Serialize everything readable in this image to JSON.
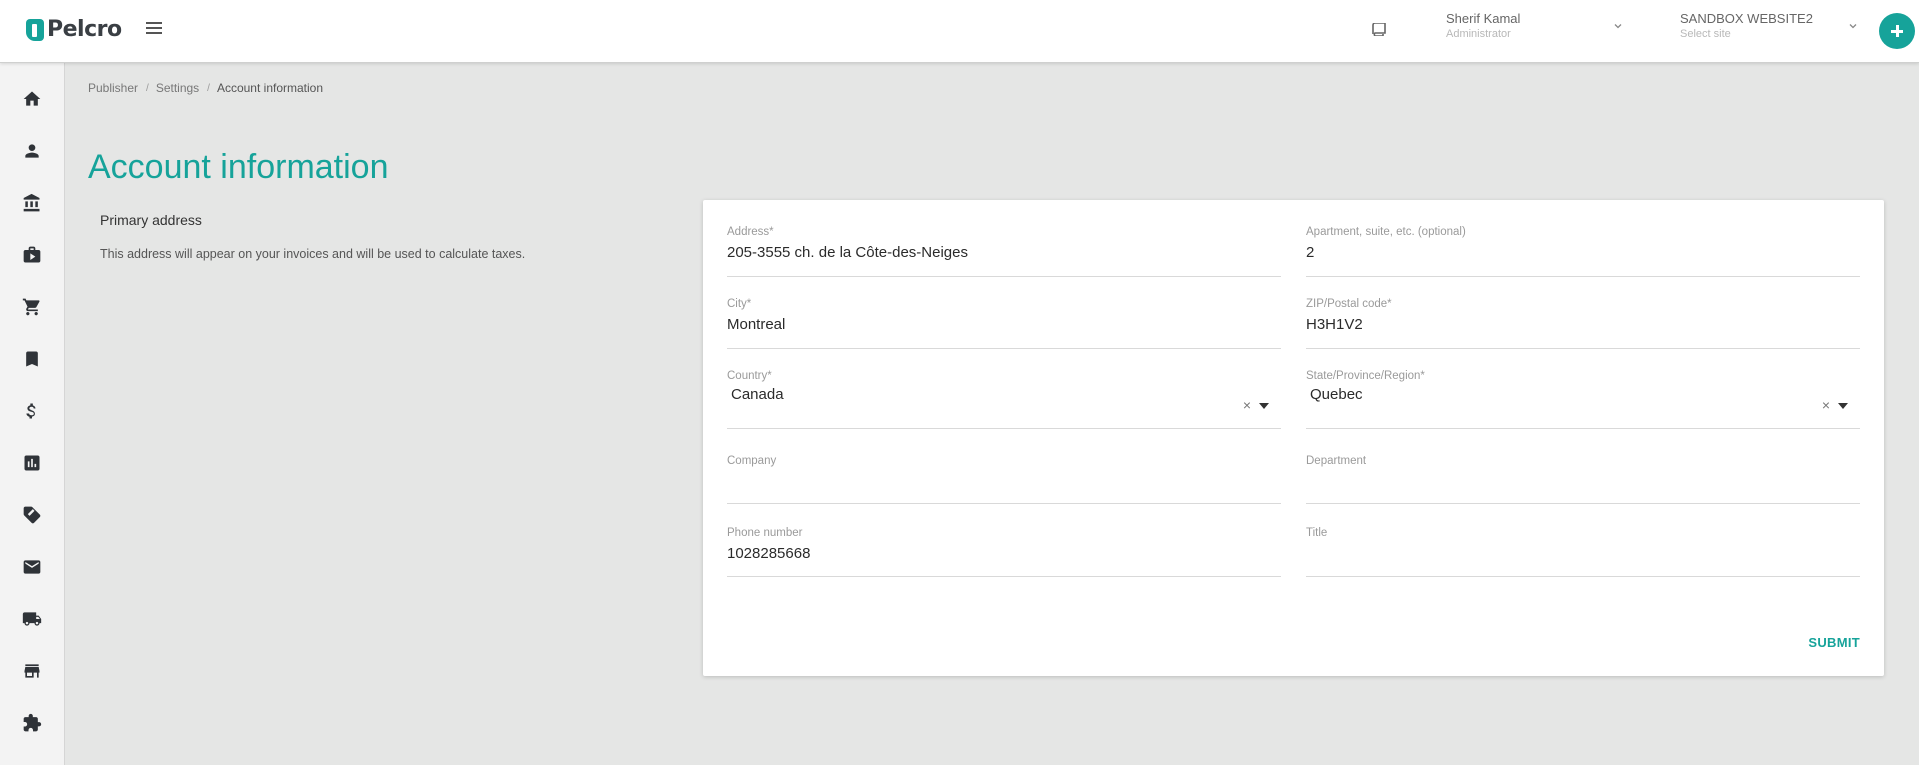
{
  "brand": {
    "name": "Pelcro",
    "accent": "#16a39a"
  },
  "header": {
    "user_name": "Sherif Kamal",
    "user_role": "Administrator",
    "site_name": "SANDBOX WEBSITE2",
    "site_placeholder": "Select site"
  },
  "sidebar": {
    "items": [
      {
        "icon": "home-icon"
      },
      {
        "icon": "person-icon"
      },
      {
        "icon": "bank-icon"
      },
      {
        "icon": "briefcase-icon"
      },
      {
        "icon": "cart-icon"
      },
      {
        "icon": "bookmark-icon"
      },
      {
        "icon": "dollar-icon"
      },
      {
        "icon": "chart-icon"
      },
      {
        "icon": "ticket-icon"
      },
      {
        "icon": "mail-icon"
      },
      {
        "icon": "truck-icon"
      },
      {
        "icon": "store-icon"
      },
      {
        "icon": "puzzle-icon"
      }
    ]
  },
  "breadcrumb": {
    "items": [
      "Publisher",
      "Settings",
      "Account information"
    ]
  },
  "page": {
    "title": "Account information",
    "section_title": "Primary address",
    "section_desc": "This address will appear on your invoices and will be used to calculate taxes."
  },
  "form": {
    "address": {
      "label": "Address*",
      "value": "205-3555 ch. de la Côte-des-Neiges"
    },
    "apartment": {
      "label": "Apartment, suite, etc. (optional)",
      "value": "2"
    },
    "city": {
      "label": "City*",
      "value": "Montreal"
    },
    "zip": {
      "label": "ZIP/Postal code*",
      "value": "H3H1V2"
    },
    "country": {
      "label": "Country*",
      "value": "Canada"
    },
    "state": {
      "label": "State/Province/Region*",
      "value": "Quebec"
    },
    "company": {
      "label": "Company",
      "value": ""
    },
    "department": {
      "label": "Department",
      "value": ""
    },
    "phone": {
      "label": "Phone number",
      "value": "1028285668"
    },
    "title": {
      "label": "Title",
      "value": ""
    },
    "submit_label": "SUBMIT"
  }
}
